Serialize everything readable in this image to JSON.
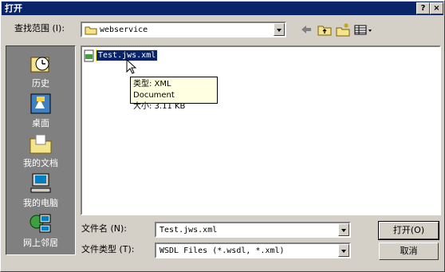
{
  "window": {
    "title": "打开"
  },
  "titlebar_buttons": {
    "help": "?",
    "close": "×"
  },
  "lookin": {
    "label": "查找范围 (I):",
    "value": "webservice",
    "icon": "folder-icon"
  },
  "toolbar": {
    "icons": [
      "back-arrow-icon",
      "up-folder-icon",
      "new-folder-icon",
      "view-menu-icon"
    ]
  },
  "places": [
    {
      "label": "历史",
      "icon": "history-icon"
    },
    {
      "label": "桌面",
      "icon": "desktop-icon"
    },
    {
      "label": "我的文档",
      "icon": "my-documents-icon"
    },
    {
      "label": "我的电脑",
      "icon": "my-computer-icon"
    },
    {
      "label": "网上邻居",
      "icon": "network-icon"
    }
  ],
  "files": [
    {
      "name": "Test.jws.xml",
      "icon": "xml-file-icon",
      "selected": true
    }
  ],
  "tooltip": {
    "type_line": "类型: XML Document",
    "size_line": "大小: 3.11 KB"
  },
  "filename": {
    "label": "文件名 (N):",
    "value": "Test.jws.xml"
  },
  "filetype": {
    "label": "文件类型 (T):",
    "value": "WSDL Files (*.wsdl, *.xml)"
  },
  "buttons": {
    "open": "打开(O)",
    "cancel": "取消"
  },
  "colors": {
    "title_bar": "#0a246a",
    "face": "#d4d0c8",
    "sidebar": "#808080",
    "tooltip": "#ffffe1"
  }
}
